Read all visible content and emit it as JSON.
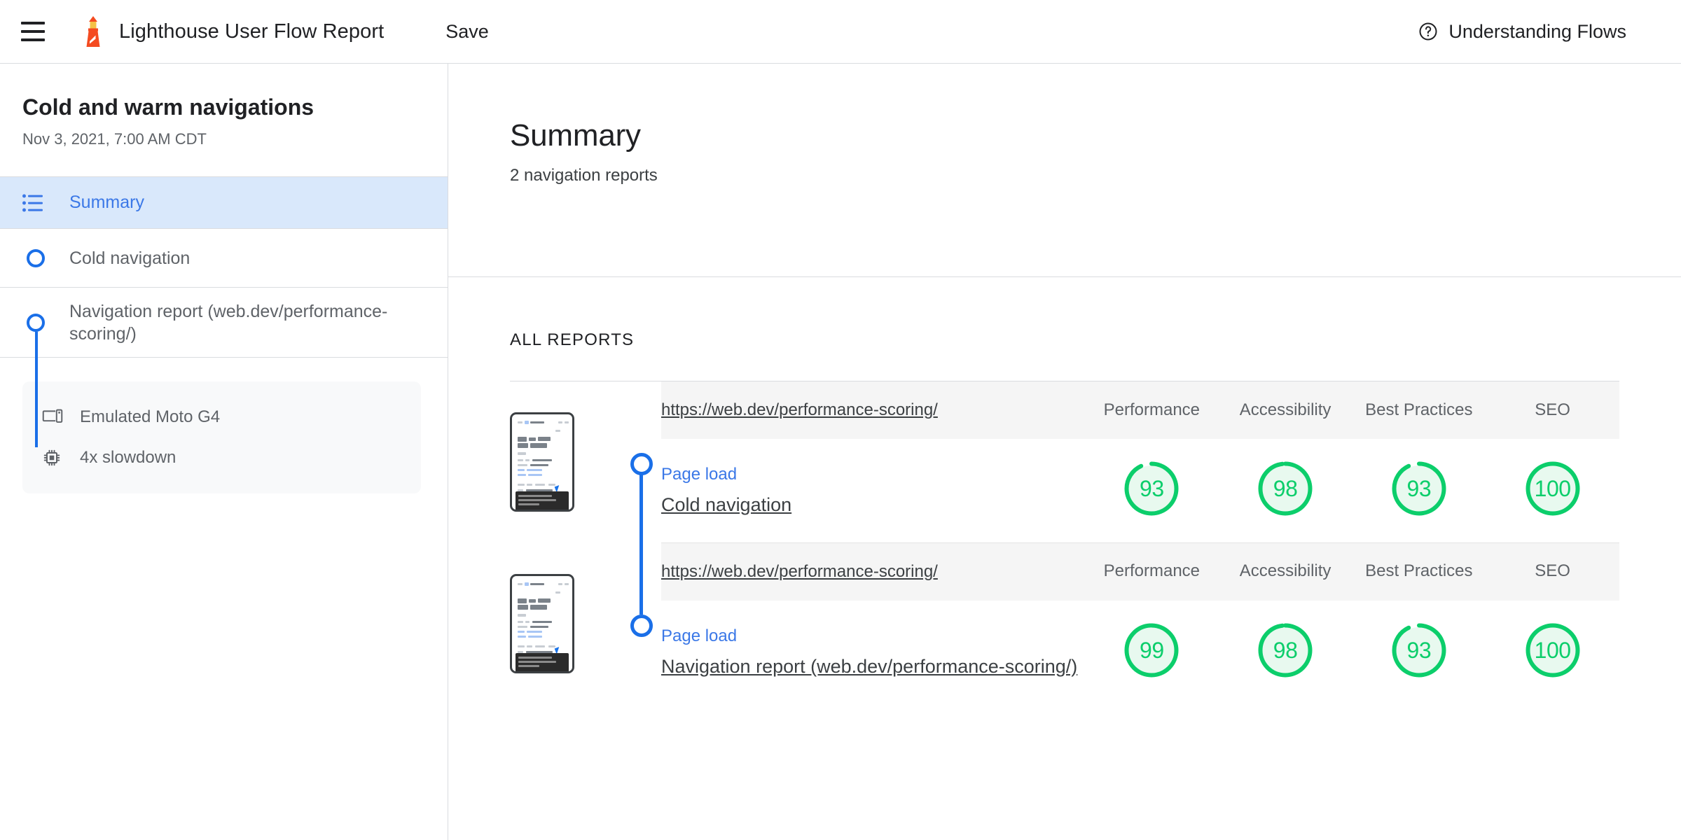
{
  "topbar": {
    "menu_icon": "hamburger-menu-icon",
    "logo_icon": "lighthouse-logo-icon",
    "title": "Lighthouse User Flow Report",
    "save_label": "Save",
    "help_icon": "help-circle-icon",
    "understanding_flows_label": "Understanding Flows"
  },
  "sidebar": {
    "flow_title": "Cold and warm navigations",
    "flow_date": "Nov 3, 2021, 7:00 AM CDT",
    "nav": [
      {
        "label": "Summary",
        "icon": "list-icon",
        "active": true
      }
    ],
    "steps": [
      {
        "label": "Cold navigation"
      },
      {
        "label": "Navigation report (web.dev/performance-scoring/)"
      }
    ],
    "device": [
      {
        "icon": "device-mobile-icon",
        "text": "Emulated Moto G4"
      },
      {
        "icon": "cpu-chip-icon",
        "text": "4x slowdown"
      }
    ]
  },
  "main": {
    "title": "Summary",
    "subtitle": "2 navigation reports",
    "section_label": "ALL REPORTS",
    "columns": [
      "Performance",
      "Accessibility",
      "Best Practices",
      "SEO"
    ],
    "reports": [
      {
        "url": "https://web.dev/performance-scoring/",
        "step_type": "Page load",
        "name": "Cold navigation",
        "scores": [
          93,
          98,
          93,
          100
        ]
      },
      {
        "url": "https://web.dev/performance-scoring/",
        "step_type": "Page load",
        "name": "Navigation report (web.dev/performance-scoring/)",
        "scores": [
          99,
          98,
          93,
          100
        ]
      }
    ]
  },
  "colors": {
    "accent_blue": "#1a6fe8",
    "link_blue": "#3b78e7",
    "active_bg": "#d9e8fb",
    "score_green": "#0cce6b",
    "score_green_bg": "#e8f9ef",
    "lighthouse_orange": "#f44b21",
    "lighthouse_lamp": "#f5c247",
    "text_primary": "#202124",
    "text_secondary": "#5f6368",
    "border": "#dadce0"
  }
}
